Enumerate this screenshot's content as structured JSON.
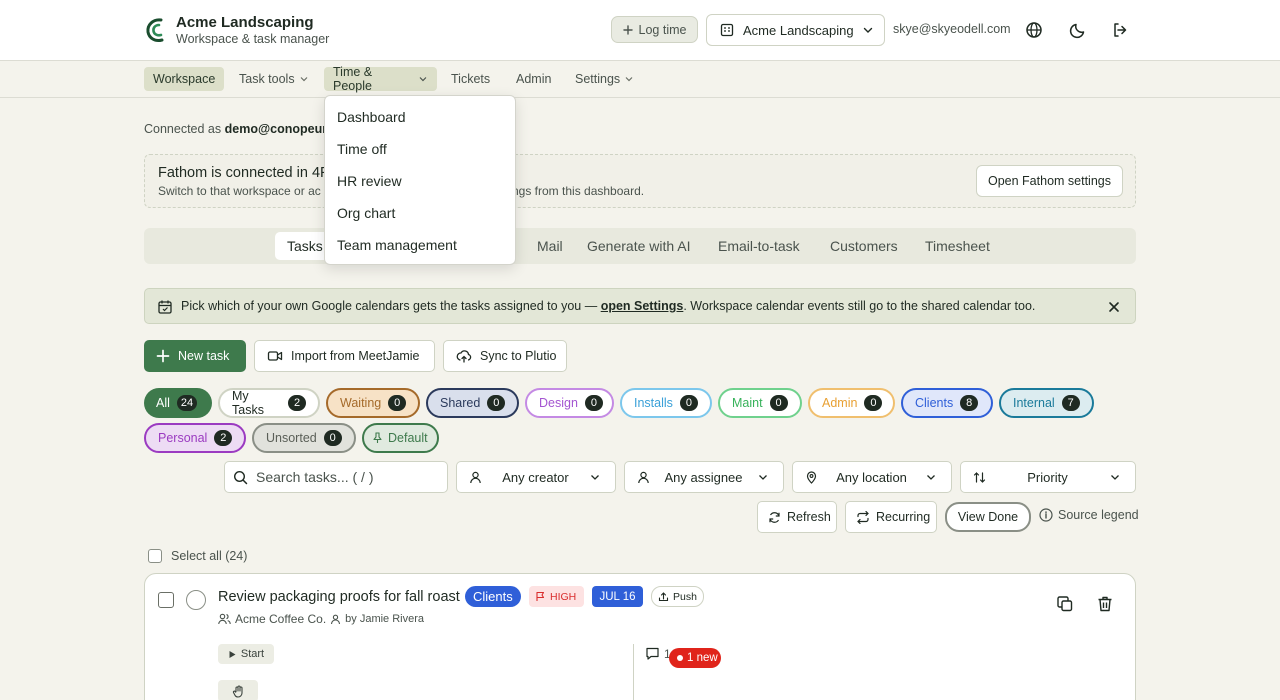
{
  "header": {
    "brand_name": "Acme Landscaping",
    "brand_subtitle": "Workspace & task manager",
    "log_time_label": "Log time",
    "workspace_selected": "Acme Landscaping",
    "user_email": "skye@skyeodell.com",
    "icons": [
      "globe-icon",
      "moon-icon",
      "logout-icon"
    ]
  },
  "nav": {
    "items": [
      "Workspace",
      "Task tools",
      "Time & People",
      "Tickets",
      "Admin",
      "Settings"
    ],
    "active": "Workspace",
    "open_menu": "Time & People"
  },
  "dropdown": {
    "items": [
      "Dashboard",
      "Time off",
      "HR review",
      "Org chart",
      "Team management"
    ]
  },
  "connection": {
    "prefix": "Connected as",
    "account": "demo@conopeum"
  },
  "fathom": {
    "title": "Fathom is connected in 4P",
    "subtitle_left": "Switch to that workspace or ac",
    "subtitle_right": "tings from this dashboard.",
    "open_button": "Open Fathom settings"
  },
  "tabs": {
    "items": [
      "Tasks",
      "Mail",
      "Generate with AI",
      "Email-to-task",
      "Customers",
      "Timesheet"
    ],
    "active": "Tasks"
  },
  "banner": {
    "text_before": "Pick which of your own Google calendars gets the tasks assigned to you —",
    "link": "open Settings",
    "text_after": ". Workspace calendar events still go to the shared calendar too."
  },
  "actions": {
    "new_task": "New task",
    "import": "Import from MeetJamie",
    "sync": "Sync to Plutio"
  },
  "chips": [
    {
      "label": "All",
      "count": "24",
      "color": "#3e7a4c"
    },
    {
      "label": "My Tasks",
      "count": "2",
      "color": "#1f2a22"
    },
    {
      "label": "Waiting",
      "count": "0",
      "color": "#a56a2a"
    },
    {
      "label": "Shared",
      "count": "0",
      "color": "#2b3a5c"
    },
    {
      "label": "Design",
      "count": "0",
      "color": "#a455d1"
    },
    {
      "label": "Installs",
      "count": "0",
      "color": "#3aa0d8"
    },
    {
      "label": "Maint",
      "count": "0",
      "color": "#37b25a"
    },
    {
      "label": "Admin",
      "count": "0",
      "color": "#e8a033"
    },
    {
      "label": "Clients",
      "count": "8",
      "color": "#2f5fd8"
    },
    {
      "label": "Internal",
      "count": "7",
      "color": "#1a7a9a"
    },
    {
      "label": "Personal",
      "count": "2",
      "color": "#9b3bc1"
    },
    {
      "label": "Unsorted",
      "count": "0",
      "color": "#6b6f66"
    },
    {
      "label": "Default",
      "count": "",
      "color": "#3e7a4c"
    }
  ],
  "filters": {
    "search_placeholder": "Search tasks... ( / )",
    "creator": "Any creator",
    "assignee": "Any assignee",
    "location": "Any location",
    "sort": "Priority"
  },
  "tools": {
    "refresh": "Refresh",
    "recurring": "Recurring",
    "view_done": "View Done",
    "source_legend": "Source legend"
  },
  "list": {
    "select_all": "Select all (24)"
  },
  "task": {
    "title": "Review packaging proofs for fall roast",
    "tag": "Clients",
    "priority": "HIGH",
    "due": "JUL 16",
    "push": "Push",
    "client": "Acme Coffee Co.",
    "creator": "by Jamie Rivera",
    "start": "Start",
    "comment_count": "1",
    "new_badge": "1 new"
  },
  "colors": {
    "accent_green": "#3e7a4c",
    "background": "#f4f3ec",
    "due_blue": "#2f5fd8",
    "new_red": "#e0241b"
  }
}
